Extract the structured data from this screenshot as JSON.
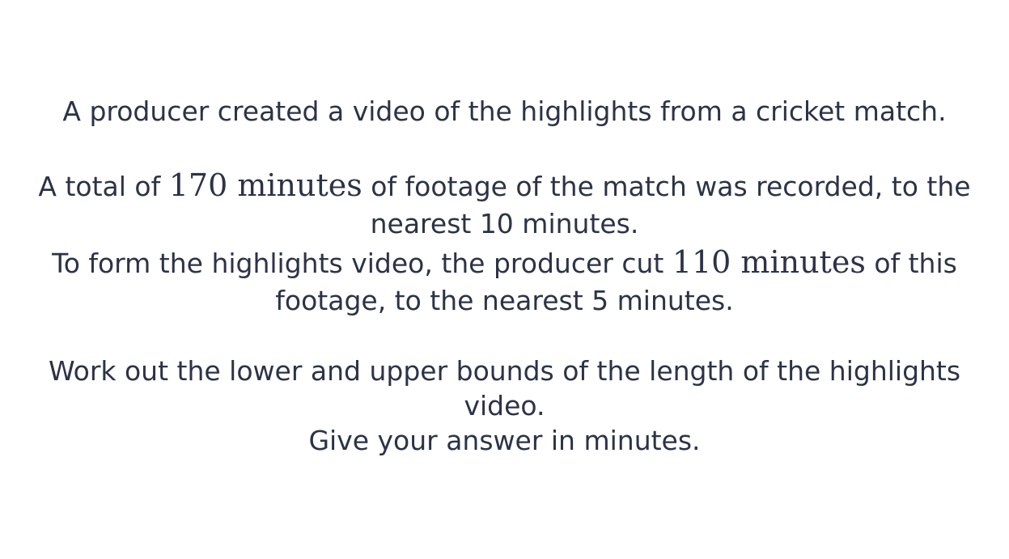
{
  "question": {
    "intro": "A producer created a video of the highlights from a cricket match.",
    "recorded_line1_before": "A total of ",
    "recorded_math": "170 minutes",
    "recorded_line1_after": " of footage of the match was recorded, to the",
    "recorded_line2": "nearest 10 minutes.",
    "cut_line1_before": "To form the highlights video, the producer cut ",
    "cut_math": "110 minutes",
    "cut_line1_after": " of this",
    "cut_line2": "footage, to the nearest 5 minutes.",
    "task_line1": "Work out the lower and upper bounds of the length of the highlights",
    "task_line2": "video.",
    "instruction": "Give your answer in minutes."
  }
}
